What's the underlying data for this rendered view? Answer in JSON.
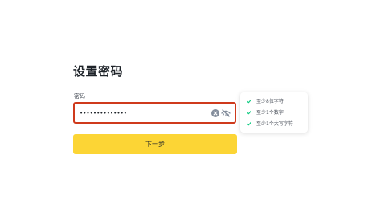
{
  "page": {
    "title": "设置密码"
  },
  "password": {
    "label": "密码",
    "value": "••••••••••••••"
  },
  "next_button": {
    "label": "下一步"
  },
  "rules": [
    {
      "text": "至少8位字符",
      "met": true
    },
    {
      "text": "至少1个数字",
      "met": true
    },
    {
      "text": "至少1个大写字符",
      "met": true
    }
  ],
  "colors": {
    "accent": "#fcd535",
    "error_border": "#cf3a1c",
    "check": "#0ecb81",
    "text": "#1e2329"
  },
  "icons": {
    "clear": "clear-circle-icon",
    "visibility": "eye-off-icon",
    "check": "check-icon"
  }
}
